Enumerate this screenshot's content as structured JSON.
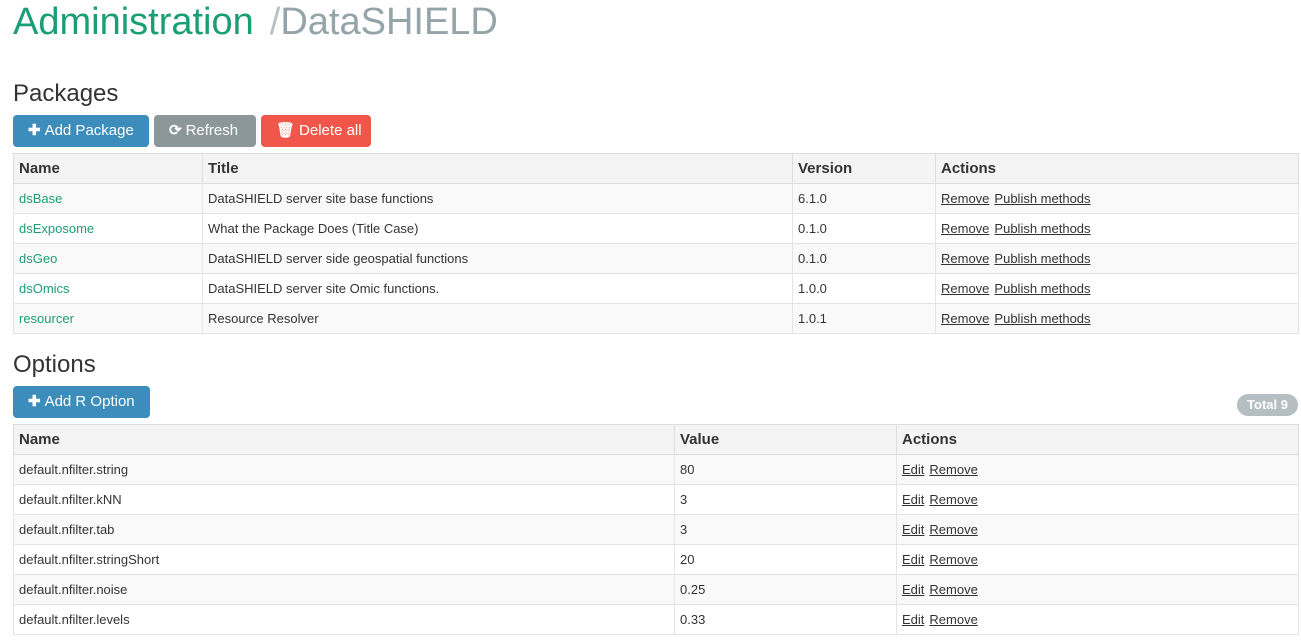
{
  "header": {
    "title": "Administration",
    "separator": "/",
    "current": "DataSHIELD"
  },
  "packages": {
    "heading": "Packages",
    "buttons": {
      "add": "Add Package",
      "refresh": "Refresh",
      "delete_all": "Delete all"
    },
    "columns": [
      "Name",
      "Title",
      "Version",
      "Actions"
    ],
    "rows": [
      {
        "name": "dsBase",
        "title": "DataSHIELD server site base functions",
        "version": "6.1.0",
        "remove": "Remove",
        "publish": "Publish methods"
      },
      {
        "name": "dsExposome",
        "title": "What the Package Does (Title Case)",
        "version": "0.1.0",
        "remove": "Remove",
        "publish": "Publish methods"
      },
      {
        "name": "dsGeo",
        "title": "DataSHIELD server side geospatial functions",
        "version": "0.1.0",
        "remove": "Remove",
        "publish": "Publish methods"
      },
      {
        "name": "dsOmics",
        "title": "DataSHIELD server site Omic functions.",
        "version": "1.0.0",
        "remove": "Remove",
        "publish": "Publish methods"
      },
      {
        "name": "resourcer",
        "title": "Resource Resolver",
        "version": "1.0.1",
        "remove": "Remove",
        "publish": "Publish methods"
      }
    ]
  },
  "options": {
    "heading": "Options",
    "add_button": "Add R Option",
    "total_badge": "Total 9",
    "columns": [
      "Name",
      "Value",
      "Actions"
    ],
    "rows": [
      {
        "name": "default.nfilter.string",
        "value": "80",
        "edit": "Edit",
        "remove": "Remove"
      },
      {
        "name": "default.nfilter.kNN",
        "value": "3",
        "edit": "Edit",
        "remove": "Remove"
      },
      {
        "name": "default.nfilter.tab",
        "value": "3",
        "edit": "Edit",
        "remove": "Remove"
      },
      {
        "name": "default.nfilter.stringShort",
        "value": "20",
        "edit": "Edit",
        "remove": "Remove"
      },
      {
        "name": "default.nfilter.noise",
        "value": "0.25",
        "edit": "Edit",
        "remove": "Remove"
      },
      {
        "name": "default.nfilter.levels",
        "value": "0.33",
        "edit": "Edit",
        "remove": "Remove"
      }
    ]
  },
  "icons": {
    "add": "plus-icon",
    "refresh": "refresh-icon",
    "delete": "trash-icon"
  },
  "colors": {
    "brand_green": "#1a9e74",
    "primary": "#3c8dbc",
    "default": "#8c9799",
    "danger": "#f0574a"
  }
}
